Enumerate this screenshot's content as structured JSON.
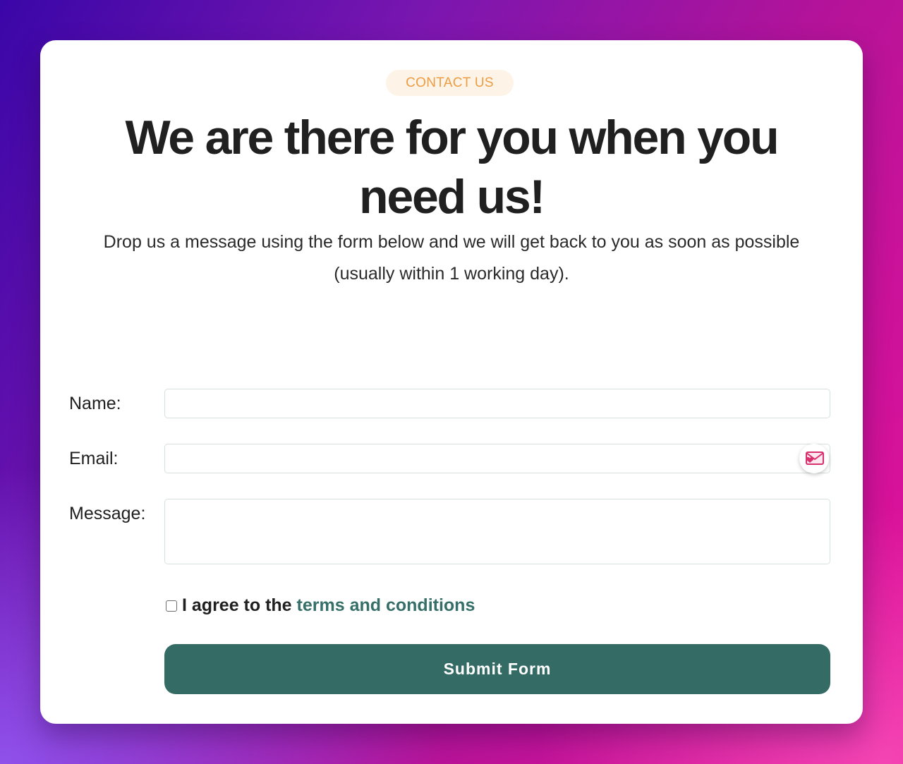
{
  "theme": {
    "accent": "#356b65",
    "link_color": "#356f68",
    "pill_text_color": "#ec9d45",
    "pill_bg_color": "#fdf3e6"
  },
  "contact": {
    "pill_label": "CONTACT US",
    "headline": "We are there for you when you need us!",
    "description": "Drop us a message using the form below and we will get back to you as soon as possible (usually within 1 working day)."
  },
  "form": {
    "name_label": "Name:",
    "name_value": "",
    "email_label": "Email:",
    "email_value": "",
    "email_badge_icon": "mail-heart-icon",
    "message_label": "Message:",
    "message_value": "",
    "agree_checked": false,
    "agree_prefix": "I agree to the ",
    "terms_link": "terms and conditions",
    "submit_label": "Submit Form"
  }
}
